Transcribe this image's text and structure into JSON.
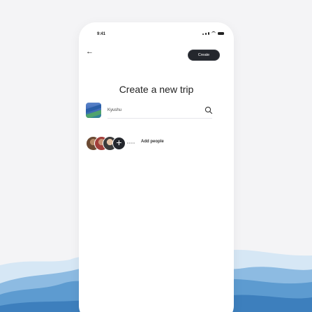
{
  "status_bar": {
    "time": "9:41"
  },
  "header": {
    "back_icon": "←",
    "create_label": "Create"
  },
  "page_title": "Create a new trip",
  "trip": {
    "name": "Kyushu"
  },
  "people": {
    "add_label": "Add people",
    "add_icon": "+"
  },
  "colors": {
    "primary_button": "#24272d",
    "background": "#f4f4f6",
    "mountain_dark": "#3d7fbd",
    "mountain_light": "#a7cbe8"
  }
}
